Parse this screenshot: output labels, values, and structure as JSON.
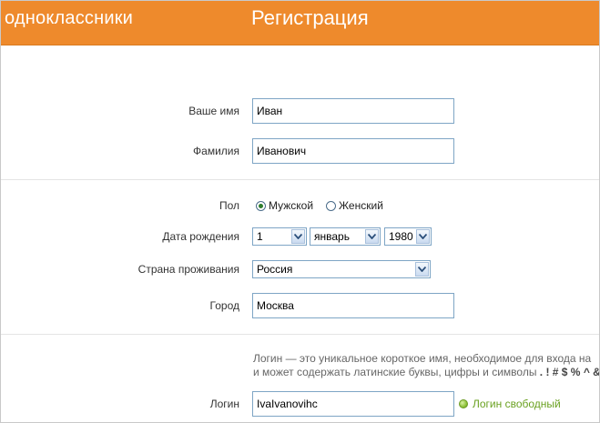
{
  "header": {
    "logo": "одноклассники",
    "title": "Регистрация"
  },
  "colors": {
    "brand": "#ee8a2c",
    "input_border": "#7ea5c5",
    "success": "#6aa121"
  },
  "form": {
    "first_name": {
      "label": "Ваше имя",
      "value": "Иван"
    },
    "last_name": {
      "label": "Фамилия",
      "value": "Иванович"
    },
    "gender": {
      "label": "Пол",
      "options": [
        "Мужской",
        "Женский"
      ],
      "selected": "Мужской"
    },
    "birth_date": {
      "label": "Дата рождения",
      "day": "1",
      "month": "январь",
      "year": "1980"
    },
    "country": {
      "label": "Страна проживания",
      "value": "Россия"
    },
    "city": {
      "label": "Город",
      "value": "Москва"
    },
    "login": {
      "hint_line1": "Логин — это уникальное короткое имя, необходимое для входа на",
      "hint_line2_text": "и может содержать латинские буквы, цифры и символы",
      "hint_line2_symbols": ". ! # $ % ^ &",
      "label": "Логин",
      "value": "IvaIvanovihc",
      "status": "Логин свободный"
    }
  },
  "icons": {
    "select_arrow": "chevron-down-icon",
    "status": "green-dot-icon"
  }
}
